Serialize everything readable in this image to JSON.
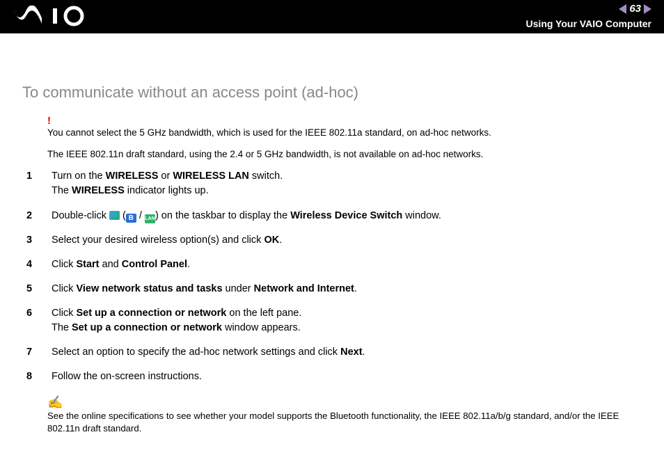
{
  "header": {
    "page_number": "63",
    "chapter": "Using Your VAIO Computer"
  },
  "title": "To communicate without an access point (ad-hoc)",
  "warning": "You cannot select the 5 GHz bandwidth, which is used for the IEEE 802.11a standard, on ad-hoc networks.",
  "info": "The IEEE 802.11n draft standard, using the 2.4 or 5 GHz bandwidth, is not available on ad-hoc networks.",
  "steps": {
    "s1a": "Turn on the ",
    "s1b": "WIRELESS",
    "s1c": " or ",
    "s1d": "WIRELESS LAN",
    "s1e": " switch.",
    "s1f": "The ",
    "s1g": "WIRELESS",
    "s1h": " indicator lights up.",
    "s2a": "Double-click ",
    "s2b": " (",
    "s2c": " / ",
    "s2d": ") on the taskbar to display the ",
    "s2e": "Wireless Device Switch",
    "s2f": " window.",
    "iconB": "B",
    "iconLAN": "LAN",
    "s3a": "Select your desired wireless option(s) and click ",
    "s3b": "OK",
    "s3c": ".",
    "s4a": "Click ",
    "s4b": "Start",
    "s4c": " and ",
    "s4d": "Control Panel",
    "s4e": ".",
    "s5a": "Click ",
    "s5b": "View network status and tasks",
    "s5c": " under ",
    "s5d": "Network and Internet",
    "s5e": ".",
    "s6a": "Click ",
    "s6b": "Set up a connection or network",
    "s6c": " on the left pane.",
    "s6d": "The ",
    "s6e": "Set up a connection or network",
    "s6f": " window appears.",
    "s7a": "Select an option to specify the ad-hoc network settings and click ",
    "s7b": "Next",
    "s7c": ".",
    "s8": "Follow the on-screen instructions."
  },
  "nums": {
    "n1": "1",
    "n2": "2",
    "n3": "3",
    "n4": "4",
    "n5": "5",
    "n6": "6",
    "n7": "7",
    "n8": "8"
  },
  "note": "See the online specifications to see whether your model supports the Bluetooth functionality, the IEEE 802.11a/b/g standard, and/or the IEEE 802.11n draft standard."
}
